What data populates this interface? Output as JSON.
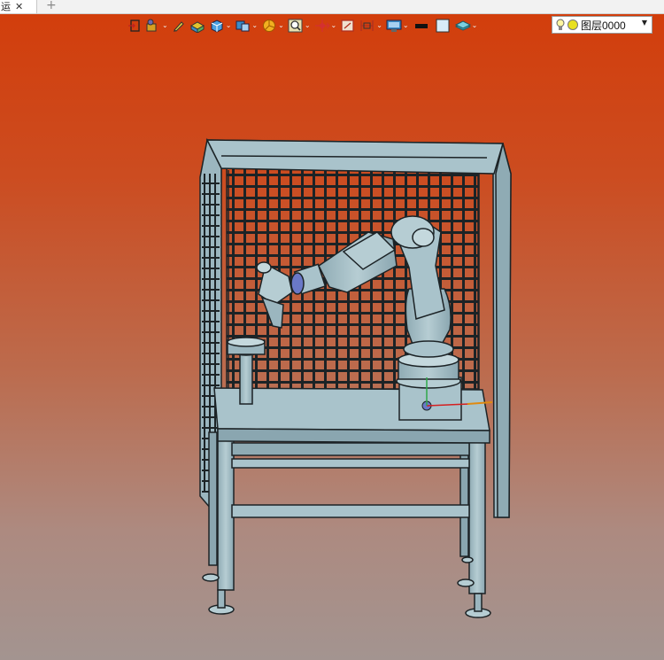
{
  "tab": {
    "title": "运",
    "close_glyph": "✕",
    "add_glyph": "+"
  },
  "toolbar": {
    "buttons": [
      {
        "name": "exit-sketch-icon",
        "dropdown": false
      },
      {
        "name": "component-style-icon",
        "dropdown": true
      },
      {
        "name": "pencil-icon",
        "dropdown": false
      },
      {
        "name": "shaded-box-icon",
        "dropdown": false
      },
      {
        "name": "render-mode-icon",
        "dropdown": true
      },
      {
        "name": "view-style-icon",
        "dropdown": true
      },
      {
        "name": "render-quality-icon",
        "dropdown": true
      },
      {
        "name": "zoom-icon",
        "dropdown": true
      },
      {
        "name": "orbit-icon",
        "dropdown": true
      },
      {
        "name": "section-view-icon",
        "dropdown": false
      },
      {
        "name": "align-icon",
        "dropdown": true
      },
      {
        "name": "monitor-display-icon",
        "dropdown": true
      },
      {
        "name": "line-color-icon",
        "dropdown": false
      },
      {
        "name": "fill-color-icon",
        "dropdown": false
      },
      {
        "name": "layers-icon",
        "dropdown": true
      }
    ],
    "chevron_glyph": "⌄",
    "layer": {
      "label": "图层0000",
      "arrow_glyph": "▼"
    }
  },
  "colors": {
    "viewport_top": "#d23e0c",
    "viewport_bottom": "#a39490",
    "model_fill": "#9bb6bf",
    "model_stroke": "#1c2326"
  }
}
